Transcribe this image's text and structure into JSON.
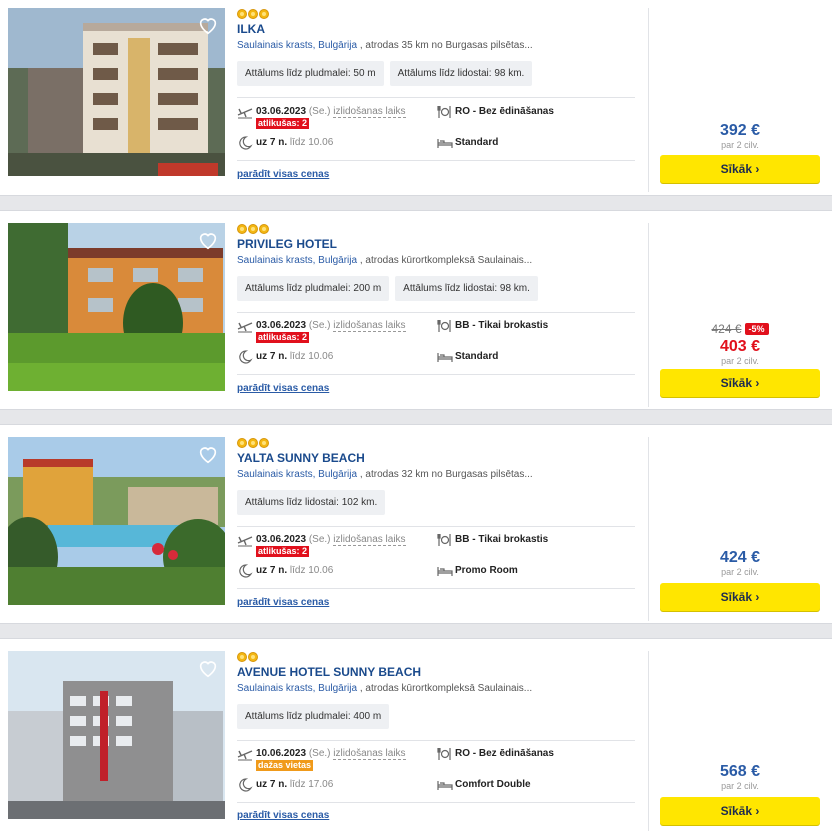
{
  "ui": {
    "details_label": "Sīkāk ›",
    "show_all_prices": "parādīt visas cenas",
    "per_label": "par 2 cilv.",
    "departure_label": "izlidošanas laiks"
  },
  "colors": {
    "accent": "#2a5ba6",
    "button": "#ffe600",
    "sale": "#e1101c",
    "badge_few": "#f09a1a"
  },
  "hotels": [
    {
      "name": "ILKA",
      "stars": 3,
      "location_link": "Saulainais krasts, Bulgārija",
      "location_rest": " , atrodas 35 km no Burgasas pilsētas...",
      "chips": [
        "Attālums līdz pludmalei: 50 m",
        "Attālums līdz lidostai: 98 km."
      ],
      "date": "03.06.2023",
      "weekday": "(Se.)",
      "badge": "atlikušas: 2",
      "duration": "uz 7 n.",
      "until": "līdz 10.06",
      "meal": "RO - Bez ēdināšanas",
      "room": "Standard",
      "price": "392 €"
    },
    {
      "name": "PRIVILEG HOTEL",
      "stars": 3,
      "location_link": "Saulainais krasts, Bulgārija",
      "location_rest": " , atrodas kūrortkompleksā Saulainais...",
      "chips": [
        "Attālums līdz pludmalei: 200 m",
        "Attālums līdz lidostai: 98 km."
      ],
      "date": "03.06.2023",
      "weekday": "(Se.)",
      "badge": "atlikušas: 2",
      "duration": "uz 7 n.",
      "until": "līdz 10.06",
      "meal": "BB - Tikai brokastis",
      "room": "Standard",
      "old_price": "424 €",
      "discount": "-5%",
      "price": "403 €"
    },
    {
      "name": "YALTA SUNNY BEACH",
      "stars": 3,
      "location_link": "Saulainais krasts, Bulgārija",
      "location_rest": " , atrodas 32 km no Burgasas pilsētas...",
      "chips": [
        "Attālums līdz lidostai: 102 km."
      ],
      "date": "03.06.2023",
      "weekday": "(Se.)",
      "badge": "atlikušas: 2",
      "duration": "uz 7 n.",
      "until": "līdz 10.06",
      "meal": "BB - Tikai brokastis",
      "room": "Promo Room",
      "price": "424 €"
    },
    {
      "name": "AVENUE HOTEL SUNNY BEACH",
      "stars": 2,
      "location_link": "Saulainais krasts, Bulgārija",
      "location_rest": " , atrodas kūrortkompleksā Saulainais...",
      "chips": [
        "Attālums līdz pludmalei: 400 m"
      ],
      "date": "10.06.2023",
      "weekday": "(Se.)",
      "badge": "dažas vietas",
      "duration": "uz 7 n.",
      "until": "līdz 17.06",
      "meal": "RO - Bez ēdināšanas",
      "room": "Comfort Double",
      "price": "568 €"
    }
  ]
}
